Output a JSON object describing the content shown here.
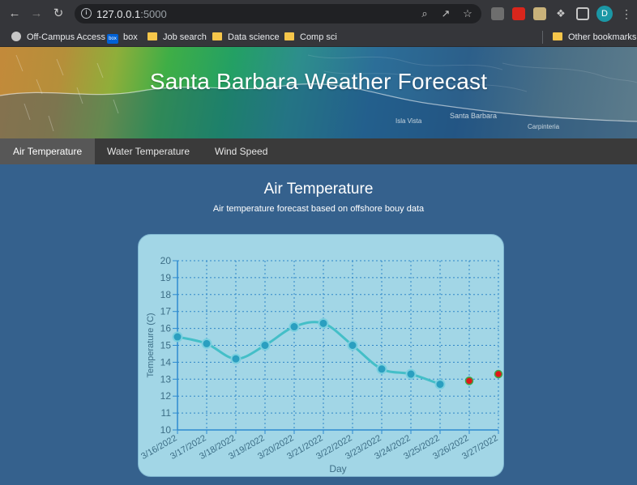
{
  "browser": {
    "url_host": "127.0.0.1",
    "url_port": ":5000",
    "profile_initial": "D",
    "bookmarks": [
      {
        "label": "Off-Campus Access",
        "icon": "globe-icon"
      },
      {
        "label": "box",
        "icon": "box-icon"
      },
      {
        "label": "Job search",
        "icon": "folder-icon"
      },
      {
        "label": "Data science",
        "icon": "folder-icon"
      },
      {
        "label": "Comp sci",
        "icon": "folder-icon"
      }
    ],
    "other_bookmarks": "Other bookmarks",
    "box_icon_text": "box"
  },
  "header": {
    "title": "Santa Barbara Weather Forecast",
    "map_labels": [
      "Isla Vista",
      "Santa Barbara",
      "Carpinteria"
    ]
  },
  "tabs": [
    {
      "label": "Air Temperature",
      "active": true
    },
    {
      "label": "Water Temperature",
      "active": false
    },
    {
      "label": "Wind Speed",
      "active": false
    }
  ],
  "main": {
    "title": "Air Temperature",
    "subtitle": "Air temperature forecast based on offshore bouy data"
  },
  "colors": {
    "line": "#44bfc8",
    "point": "#2a9fc0",
    "forecast_point": "#e01818",
    "grid": "#2f86c8",
    "axis": "#2d8ad0"
  },
  "chart_data": {
    "type": "line",
    "xlabel": "Day",
    "ylabel": "Temperature (C)",
    "ylim": [
      10,
      20
    ],
    "grid": true,
    "categories": [
      "3/16/2022",
      "3/17/2022",
      "3/18/2022",
      "3/19/2022",
      "3/20/2022",
      "3/21/2022",
      "3/22/2022",
      "3/23/2022",
      "3/24/2022",
      "3/25/2022",
      "3/26/2022",
      "3/27/2022"
    ],
    "yticks": [
      10,
      11,
      12,
      13,
      14,
      15,
      16,
      17,
      18,
      19,
      20
    ],
    "series": [
      {
        "values": [
          15.5,
          15.1,
          14.2,
          15.0,
          16.1,
          16.3,
          15.0,
          13.6,
          13.3,
          12.7,
          null,
          null
        ]
      },
      {
        "values": [
          null,
          null,
          null,
          null,
          null,
          null,
          null,
          null,
          null,
          null,
          12.9,
          13.3
        ]
      }
    ]
  }
}
